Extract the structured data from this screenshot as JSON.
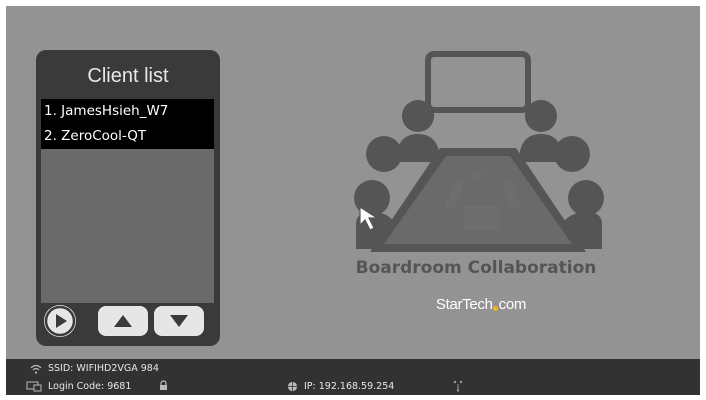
{
  "panel": {
    "title": "Client list",
    "clients": [
      "1. JamesHsieh_W7",
      "2. ZeroCool-QT"
    ]
  },
  "branding": {
    "tagline": "Boardroom Collaboration",
    "logo_text_before": "StarTech",
    "logo_text_after": "com"
  },
  "status_bar": {
    "ssid": "SSID: WIFIHD2VGA 984",
    "login_code": "Login Code: 9681",
    "ip": "IP: 192.168.59.254"
  },
  "icons": {
    "play": "play-icon",
    "up": "arrow-up-icon",
    "down": "arrow-down-icon",
    "wifi": "wifi-icon",
    "login": "monitor-icon",
    "lock": "lock-icon",
    "ip": "globe-icon",
    "network": "network-icon",
    "cursor": "mouse-cursor-icon"
  },
  "colors": {
    "background": "#939393",
    "panel": "#3a3a3a",
    "status_bar": "#323232",
    "logo_dot": "#f2b51c"
  }
}
